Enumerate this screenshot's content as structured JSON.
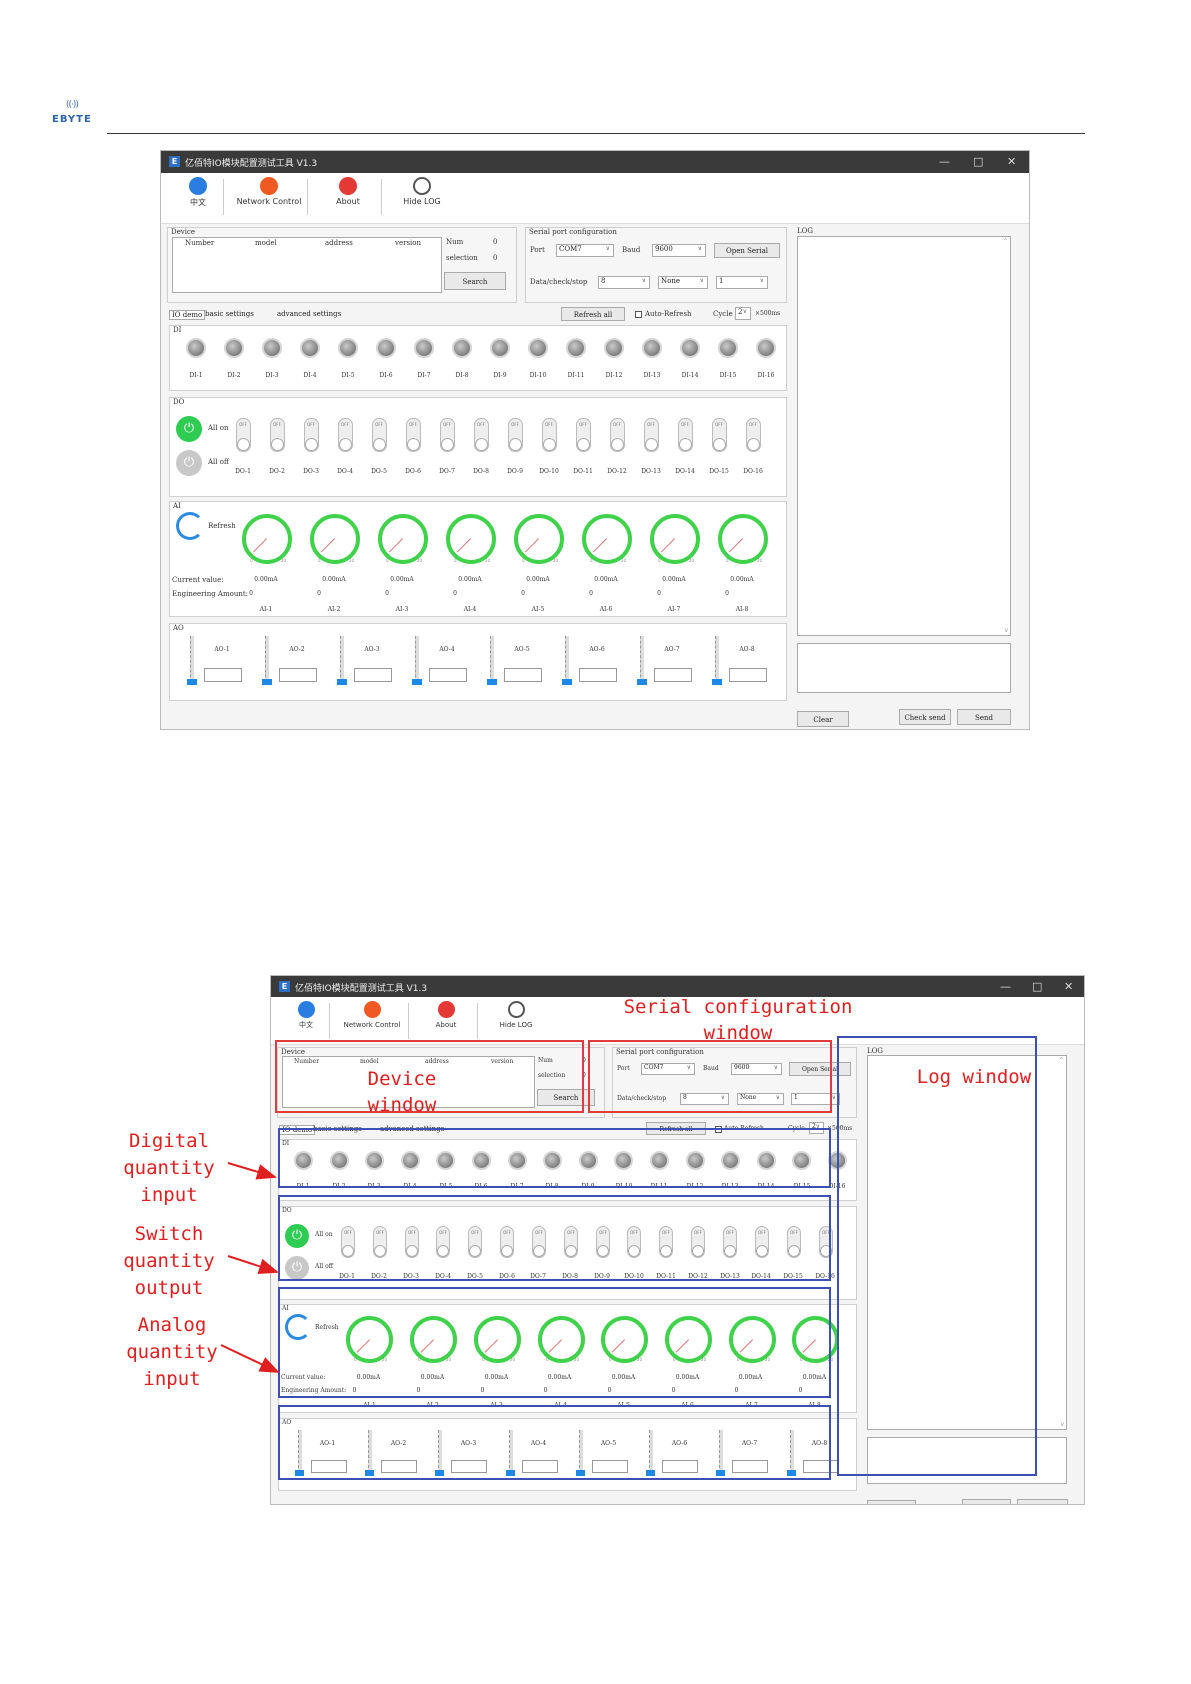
{
  "brand": {
    "waves": "((·))",
    "name": "EBYTE"
  },
  "app": {
    "title_icon": "E",
    "title": "亿佰特IO模块配置测试工具 V1.3",
    "window_buttons": [
      "—",
      "□",
      "✕"
    ],
    "toolbar": [
      {
        "icon": "language-icon",
        "label": "中文",
        "color": "#2a7de1"
      },
      {
        "icon": "network-icon",
        "label": "Network Control",
        "color": "#f05a22"
      },
      {
        "icon": "about-icon",
        "label": "About",
        "color": "#e53935"
      },
      {
        "icon": "magnifier-icon",
        "label": "Hide LOG",
        "color": "#555555"
      }
    ],
    "device": {
      "caption": "Device",
      "columns": [
        "Number",
        "model",
        "address",
        "version"
      ],
      "num_label": "Num",
      "num_value": "0",
      "selection_label": "selection",
      "selection_value": "0",
      "search_label": "Search"
    },
    "serial": {
      "caption": "Serial port configuration",
      "port_label": "Port",
      "port_value": "COM7",
      "baud_label": "Baud",
      "baud_value": "9600",
      "open_label": "Open Serial",
      "dcs_label": "Data/check/stop",
      "data_value": "8",
      "check_value": "None",
      "stop_value": "1"
    },
    "log": {
      "caption": "LOG",
      "clear_label": "Clear",
      "check_send_label": "Check send",
      "send_label": "Send"
    },
    "tabs": [
      "IO demo",
      "basic settings",
      "advanced settings"
    ],
    "refresh_all": "Refresh all",
    "auto_refresh": "Auto-Refresh",
    "cycle_label": "Cycle",
    "cycle_value": "2",
    "cycle_unit": "×500ms",
    "di": {
      "caption": "DI",
      "labels": [
        "DI-1",
        "DI-2",
        "DI-3",
        "DI-4",
        "DI-5",
        "DI-6",
        "DI-7",
        "DI-8",
        "DI-9",
        "DI-10",
        "DI-11",
        "DI-12",
        "DI-13",
        "DI-14",
        "DI-15",
        "DI-16"
      ]
    },
    "do": {
      "caption": "DO",
      "all_on": "All on",
      "all_off": "All off",
      "toggle_text": "OFF",
      "labels": [
        "DO-1",
        "DO-2",
        "DO-3",
        "DO-4",
        "DO-5",
        "DO-6",
        "DO-7",
        "DO-8",
        "DO-9",
        "DO-10",
        "DO-11",
        "DO-12",
        "DO-13",
        "DO-14",
        "DO-15",
        "DO-16"
      ]
    },
    "ai": {
      "caption": "AI",
      "refresh": "Refresh",
      "current_label": "Current value:",
      "eng_label": "Engineering Amount:",
      "gauge_min": "0",
      "gauge_max": "20",
      "values": [
        "0.00mA",
        "0.00mA",
        "0.00mA",
        "0.00mA",
        "0.00mA",
        "0.00mA",
        "0.00mA",
        "0.00mA"
      ],
      "eng_values": [
        "0",
        "0",
        "0",
        "0",
        "0",
        "0",
        "0",
        "0"
      ],
      "labels": [
        "AI-1",
        "AI-2",
        "AI-3",
        "AI-4",
        "AI-5",
        "AI-6",
        "AI-7",
        "AI-8"
      ]
    },
    "ao": {
      "caption": "AO",
      "labels": [
        "AO-1",
        "AO-2",
        "AO-3",
        "AO-4",
        "AO-5",
        "AO-6",
        "AO-7",
        "AO-8"
      ]
    }
  },
  "annotations": {
    "serial_window": "Serial configuration\nwindow",
    "device_window": "Device\nwindow",
    "log_window": "Log window",
    "digital_input": "Digital\nquantity\ninput",
    "switch_output": "Switch\nquantity\noutput",
    "analog_input": "Analog\nquantity\ninput"
  },
  "colors": {
    "red": "#e02020",
    "blue": "#3b4fb4",
    "green": "#3fd24a",
    "accent_blue": "#2a8be0"
  }
}
